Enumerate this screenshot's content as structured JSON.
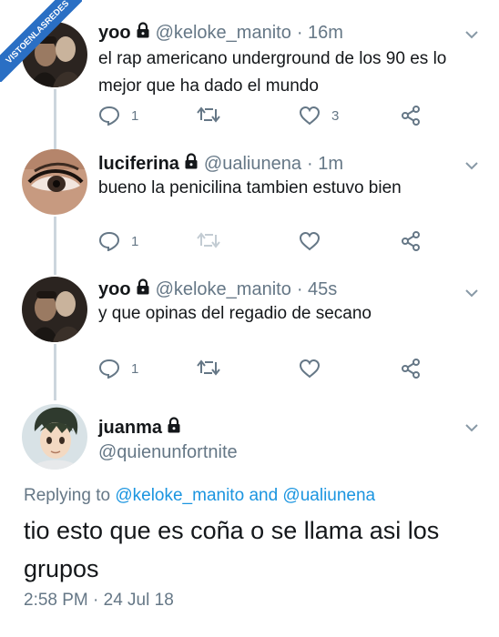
{
  "watermark": "VISTOENLASREDES",
  "tweets": [
    {
      "name": "yoo",
      "handle": "@keloke_manito",
      "time": "· 16m",
      "text": "el rap americano underground de los 90 es lo mejor que ha dado el mundo",
      "reply_count": "1",
      "retweet_count": "",
      "like_count": "3"
    },
    {
      "name": "luciferina",
      "handle": "@ualiunena",
      "time": "· 1m",
      "text": "bueno la penicilina tambien estuvo bien",
      "reply_count": "1",
      "retweet_count": "",
      "like_count": ""
    },
    {
      "name": "yoo",
      "handle": "@keloke_manito",
      "time": "· 45s",
      "text": "y que opinas del regadio de secano",
      "reply_count": "1",
      "retweet_count": "",
      "like_count": ""
    }
  ],
  "main_tweet": {
    "name": "juanma",
    "handle": "@quienunfortnite",
    "replying_prefix": "Replying to",
    "mention1": "@keloke_manito",
    "and_word": "and",
    "mention2": "@ualiunena",
    "text": "tio esto que es coña o se llama asi los grupos",
    "timestamp": "2:58 PM · 24 Jul 18"
  },
  "icons": {
    "reply": "reply-icon",
    "retweet": "retweet-icon",
    "like": "heart-icon",
    "share": "share-icon",
    "lock": "lock-icon",
    "chevron": "chevron-down-icon"
  },
  "colors": {
    "link": "#1b95e0",
    "secondary": "#657786",
    "thread": "#ccd6dd",
    "watermark": "#2a6fc4"
  }
}
